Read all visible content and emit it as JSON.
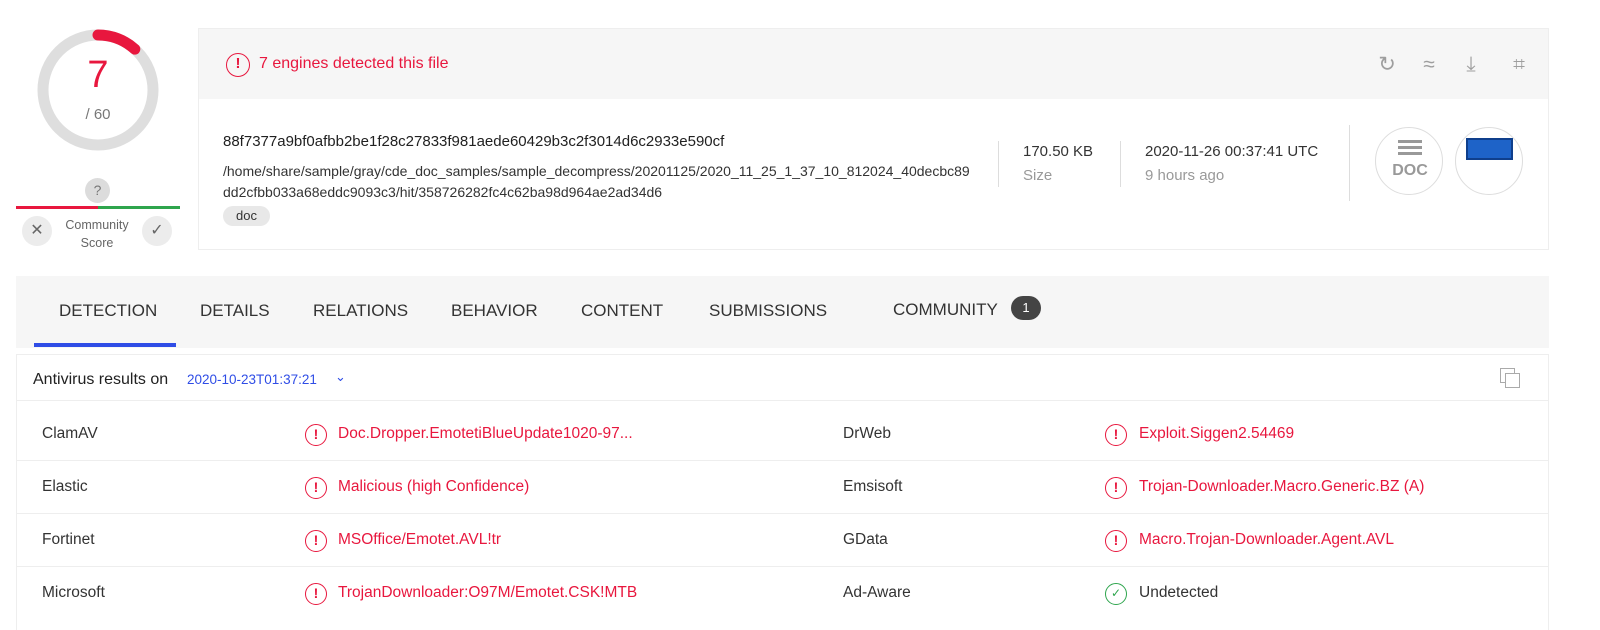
{
  "score": {
    "detected": "7",
    "total": "/ 60",
    "fraction": 0.1167
  },
  "community": {
    "question": "?",
    "label_line1": "Community",
    "label_line2": "Score",
    "down": "✕",
    "up": "✓"
  },
  "header": {
    "detection_text": "7 engines detected this file",
    "hash": "88f7377a9bf0afbb2be1f28c27833f981aede60429b3c2f3014d6c2933e590cf",
    "path": "/home/share/sample/gray/cde_doc_samples/sample_decompress/20201125/2020_11_25_1_37_10_812024_40decbc89dd2cfbb033a68eddc9093c3/hit/358726282fc4c62ba98d964ae2ad34d6",
    "tag": "doc",
    "size_value": "170.50 KB",
    "size_label": "Size",
    "date_value": "2020-11-26 00:37:41 UTC",
    "date_ago": "9 hours ago",
    "filetype": "DOC"
  },
  "icons": {
    "alert": "!",
    "reanalyze": "↻",
    "similar": "≈",
    "download": "⤓",
    "graph": "⌗"
  },
  "tabs": [
    {
      "label": "DETECTION"
    },
    {
      "label": "DETAILS"
    },
    {
      "label": "RELATIONS"
    },
    {
      "label": "BEHAVIOR"
    },
    {
      "label": "CONTENT"
    },
    {
      "label": "SUBMISSIONS"
    },
    {
      "label": "COMMUNITY",
      "badge": "1"
    }
  ],
  "results": {
    "title": "Antivirus results on",
    "date": "2020-10-23T01:37:21",
    "chevron": "⌄",
    "rows": [
      {
        "left_engine": "ClamAV",
        "left_result": "Doc.Dropper.EmotetiBlueUpdate1020-97...",
        "right_engine": "DrWeb",
        "right_result": "Exploit.Siggen2.54469"
      },
      {
        "left_engine": "Elastic",
        "left_result": "Malicious (high Confidence)",
        "right_engine": "Emsisoft",
        "right_result": "Trojan-Downloader.Macro.Generic.BZ (A)"
      },
      {
        "left_engine": "Fortinet",
        "left_result": "MSOffice/Emotet.AVL!tr",
        "right_engine": "GData",
        "right_result": "Macro.Trojan-Downloader.Agent.AVL"
      },
      {
        "left_engine": "Microsoft",
        "left_result": "TrojanDownloader:O97M/Emotet.CSK!MTB",
        "right_engine": "Ad-Aware",
        "right_result": "Undetected"
      }
    ]
  },
  "colors": {
    "danger": "#e8173e",
    "success": "#2ea54d",
    "accent": "#2f4de6"
  }
}
